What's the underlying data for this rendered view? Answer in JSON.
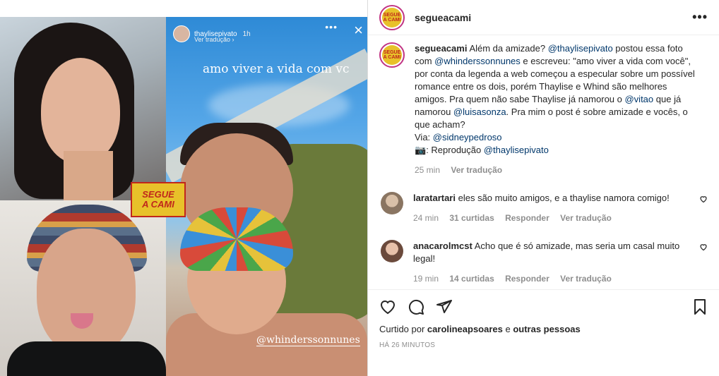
{
  "media": {
    "logo_line1": "SEGUE",
    "logo_line2": "A CAMI",
    "story": {
      "user": "thaylisepivato",
      "time": "1h",
      "sub": "Ver tradução ›",
      "caption": "amo viver a vida com vc",
      "tag": "@whinderssonnunes",
      "close_icon": "×",
      "menu_icon": "•••"
    }
  },
  "header": {
    "username": "segueacami",
    "avatar_text": "SEGUE A CAMI",
    "more_icon": "•••"
  },
  "caption": {
    "username": "segueacami",
    "t1": "Além da amizade? ",
    "m1": "@thaylisepivato",
    "t2": " postou essa foto com ",
    "m2": "@whinderssonnunes",
    "t3": " e escreveu: \"amo viver a vida com você\", por conta da legenda a web começou a especular sobre um possível romance entre os dois, porém Thaylise e Whind são melhores amigos. Pra quem não sabe Thaylise já namorou o ",
    "m3": "@vitao",
    "t4": " que já namorou ",
    "m4": "@luisasonza",
    "t5": ". Pra mim o post é sobre amizade e vocês, o que acham?",
    "via_label": "Via: ",
    "m5": "@sidneypedroso",
    "camera_emoji": "📷",
    "repro_label": ": Reprodução ",
    "m6": "@thaylisepivato",
    "time": "25 min",
    "translate": "Ver tradução"
  },
  "comments": [
    {
      "username": "laratartari",
      "text": "eles são muito amigos, e a thaylise namora comigo!",
      "time": "24 min",
      "likes": "31 curtidas",
      "reply": "Responder",
      "translate": "Ver tradução",
      "avatar_color": "#b8a08a"
    },
    {
      "username": "anacarolmcst",
      "text": "Acho que é só amizade, mas seria um casal muito legal!",
      "time": "19 min",
      "likes": "14 curtidas",
      "reply": "Responder",
      "translate": "Ver tradução",
      "avatar_color": "#c99479"
    }
  ],
  "footer": {
    "liked_prefix": "Curtido por ",
    "liked_user": "carolineapsoares",
    "liked_mid": " e ",
    "liked_others": "outras pessoas",
    "posted_time": "HÁ 26 MINUTOS"
  },
  "icons": [
    "heart-icon",
    "comment-icon",
    "share-icon",
    "bookmark-icon",
    "more-icon",
    "close-icon"
  ],
  "colors": {
    "link": "#00376b",
    "muted": "#8e8e8e",
    "brand_yellow": "#e8c12a",
    "brand_red": "#c0261c",
    "ring": "#c13584"
  }
}
